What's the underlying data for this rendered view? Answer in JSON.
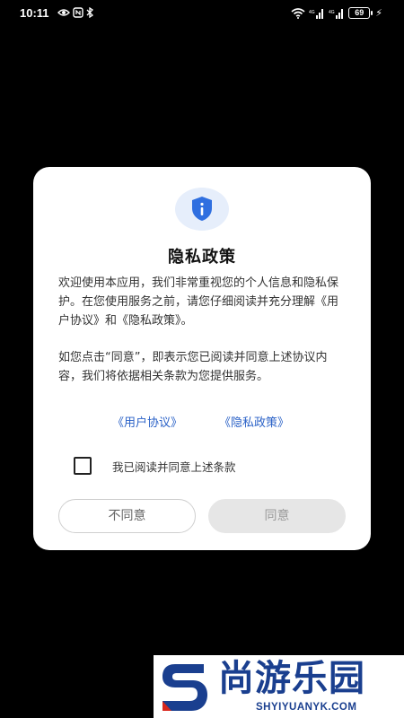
{
  "status_bar": {
    "time": "10:11",
    "battery": "69",
    "left_icons": [
      "eye-icon",
      "nfc-icon",
      "bluetooth-icon"
    ],
    "right_icons": [
      "wifi-icon",
      "signal-icon",
      "signal-icon",
      "battery-icon",
      "charging-icon"
    ]
  },
  "dialog": {
    "icon": "shield-info-icon",
    "title": "隐私政策",
    "paragraphs": [
      "欢迎使用本应用，我们非常重视您的个人信息和隐私保护。在您使用服务之前，请您仔细阅读并充分理解《用户协议》和《隐私政策》。",
      "如您点击“同意”，即表示您已阅读并同意上述协议内容，我们将依据相关条款为您提供服务。"
    ],
    "link_user_agreement": "《用户协议》",
    "link_privacy_policy": "《隐私政策》",
    "agree_checkbox_label": "我已阅读并同意上述条款",
    "agree_checked": false,
    "disagree_button": "不同意",
    "agree_button": "同意"
  },
  "watermark": {
    "name": "尚游乐园",
    "url": "SHYIYUANYK.COM"
  },
  "colors": {
    "link": "#2b62c7",
    "shield": "#2f6fe0",
    "watermark": "#1a3f8f",
    "background": "#000000"
  }
}
